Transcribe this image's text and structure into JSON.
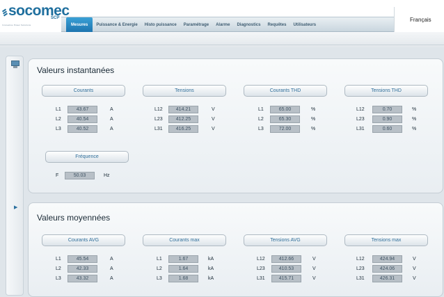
{
  "header": {
    "logo_text": "socomec",
    "logo_suffix": "SCP",
    "logo_tagline": "Innovative Power Solutions",
    "language": "Français",
    "nav": [
      "Mesures",
      "Puissance & Energie",
      "Histo puissance",
      "Paramétrage",
      "Alarme",
      "Diagnostics",
      "Requêtes",
      "Utilisateurs"
    ],
    "active_nav": "Mesures"
  },
  "colors": {
    "accent": "#1f6f9e",
    "active_tab": "#2487c2",
    "value_box": "#b8c0c7"
  },
  "instant": {
    "title": "Valeurs instantanées",
    "groups": [
      {
        "label": "Courants",
        "unit": "A",
        "rows": [
          {
            "name": "L1",
            "value": "43.67"
          },
          {
            "name": "L2",
            "value": "40.54"
          },
          {
            "name": "L3",
            "value": "40.52"
          }
        ]
      },
      {
        "label": "Tensions",
        "unit": "V",
        "rows": [
          {
            "name": "L12",
            "value": "414.21"
          },
          {
            "name": "L23",
            "value": "412.25"
          },
          {
            "name": "L31",
            "value": "416.25"
          }
        ]
      },
      {
        "label": "Courants THD",
        "unit": "%",
        "rows": [
          {
            "name": "L1",
            "value": "65.00"
          },
          {
            "name": "L2",
            "value": "65.30"
          },
          {
            "name": "L3",
            "value": "72.00"
          }
        ]
      },
      {
        "label": "Tensions THD",
        "unit": "%",
        "rows": [
          {
            "name": "L12",
            "value": "0.70"
          },
          {
            "name": "L23",
            "value": "0.90"
          },
          {
            "name": "L31",
            "value": "0.60"
          }
        ]
      }
    ],
    "frequency": {
      "label": "Fréquence",
      "name": "F",
      "value": "50.03",
      "unit": "Hz"
    }
  },
  "average": {
    "title": "Valeurs moyennées",
    "groups": [
      {
        "label": "Courants AVG",
        "unit": "A",
        "rows": [
          {
            "name": "L1",
            "value": "45.54"
          },
          {
            "name": "L2",
            "value": "42.33"
          },
          {
            "name": "L3",
            "value": "43.32"
          }
        ]
      },
      {
        "label": "Courants max",
        "unit": "kA",
        "rows": [
          {
            "name": "L1",
            "value": "1.67"
          },
          {
            "name": "L2",
            "value": "1.64"
          },
          {
            "name": "L3",
            "value": "1.68"
          }
        ]
      },
      {
        "label": "Tensions AVG",
        "unit": "V",
        "rows": [
          {
            "name": "L12",
            "value": "412.66"
          },
          {
            "name": "L23",
            "value": "410.53"
          },
          {
            "name": "L31",
            "value": "415.71"
          }
        ]
      },
      {
        "label": "Tensions max",
        "unit": "V",
        "rows": [
          {
            "name": "L12",
            "value": "424.94"
          },
          {
            "name": "L23",
            "value": "424.06"
          },
          {
            "name": "L31",
            "value": "426.31"
          }
        ]
      }
    ]
  }
}
